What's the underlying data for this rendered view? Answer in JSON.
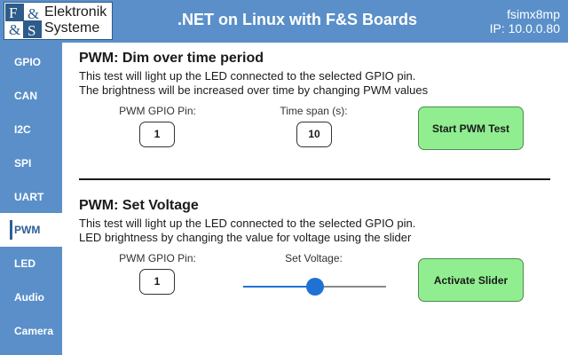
{
  "header": {
    "logo_line1": "Elektronik",
    "logo_line2": "Systeme",
    "title": ".NET on Linux with F&S Boards",
    "hostname": "fsimx8mp",
    "ip_label": "IP:",
    "ip_value": "10.0.0.80"
  },
  "sidebar": {
    "items": [
      {
        "label": "GPIO"
      },
      {
        "label": "CAN"
      },
      {
        "label": "I2C"
      },
      {
        "label": "SPI"
      },
      {
        "label": "UART"
      },
      {
        "label": "PWM"
      },
      {
        "label": "LED"
      },
      {
        "label": "Audio"
      },
      {
        "label": "Camera"
      }
    ],
    "active": "PWM"
  },
  "pwm_dim": {
    "title": "PWM: Dim over time period",
    "desc1": "This test will light up the LED connected to the selected GPIO pin.",
    "desc2": "The brightness will be increased over time by changing PWM values",
    "pin_label": "PWM GPIO Pin:",
    "pin_value": "1",
    "timespan_label": "Time span (s):",
    "timespan_value": "10",
    "button_label": "Start PWM Test"
  },
  "pwm_voltage": {
    "title": "PWM: Set Voltage",
    "desc1": "This test will light up the LED connected to the selected GPIO pin.",
    "desc2": "LED brightness by changing the value for voltage using the slider",
    "pin_label": "PWM GPIO Pin:",
    "pin_value": "1",
    "voltage_label": "Set Voltage:",
    "slider_value": 0.5,
    "button_label": "Activate Slider"
  },
  "colors": {
    "brand_blue": "#5a8fc9",
    "button_green": "#90ee90",
    "slider_accent": "#1f72d4"
  },
  "icons": {
    "logo": "fs-logo-icon"
  }
}
